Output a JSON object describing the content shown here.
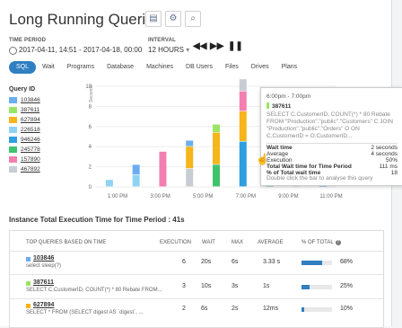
{
  "title": "Long Running Queries",
  "header": {
    "time_period_label": "TIME PERIOD",
    "time_period_value": "2017-04-11, 14:51 - 2017-04-18, 00:00",
    "interval_label": "INTERVAL",
    "interval_value": "12 HOURS",
    "interval_arrow": "▾"
  },
  "tabs": [
    "SQL",
    "Wait",
    "Programs",
    "Database",
    "Machines",
    "DB Users",
    "Files",
    "Drives",
    "Plans"
  ],
  "queries_label": "Query ID",
  "queries": [
    {
      "id": "103846",
      "color": "#6aaef0"
    },
    {
      "id": "387611",
      "color": "#9be564"
    },
    {
      "id": "627894",
      "color": "#f5b51b"
    },
    {
      "id": "226518",
      "color": "#8fd3f4"
    },
    {
      "id": "946246",
      "color": "#2f9fe0"
    },
    {
      "id": "245778",
      "color": "#3ec46d"
    },
    {
      "id": "157890",
      "color": "#f27fb0"
    },
    {
      "id": "467892",
      "color": "#c7cdd3"
    }
  ],
  "chart_data": {
    "type": "bar",
    "ylabel": "Seconds",
    "yticks": [
      "10",
      "8",
      "6",
      "4",
      "2",
      "0"
    ],
    "ylim": [
      0,
      10
    ],
    "x_ticks": [
      "1:00 PM",
      "3:00 PM",
      "5:00 PM",
      "7:00 PM",
      "9:00 PM",
      "11:00 PM"
    ],
    "series_colors": [
      "#6aaef0",
      "#9be564",
      "#f5b51b",
      "#8fd3f4",
      "#2f9fe0",
      "#3ec46d",
      "#f27fb0",
      "#c7cdd3"
    ],
    "bars": [
      {
        "stack": [
          [
            0.7,
            "#8fd3f4"
          ]
        ]
      },
      {
        "stack": [
          [
            1.2,
            "#8fd3f4"
          ],
          [
            1.0,
            "#6aaef0"
          ]
        ]
      },
      {
        "stack": [
          [
            3.5,
            "#f27fb0"
          ]
        ]
      },
      {
        "stack": [
          [
            1.8,
            "#c7cdd3"
          ],
          [
            2.2,
            "#f5b51b"
          ],
          [
            0.6,
            "#6aaef0"
          ]
        ]
      },
      {
        "stack": [
          [
            2.2,
            "#3ec46d"
          ],
          [
            3.2,
            "#f5b51b"
          ],
          [
            0.8,
            "#9be564"
          ]
        ]
      },
      {
        "stack": [
          [
            4.5,
            "#2f9fe0"
          ],
          [
            3.0,
            "#f5b51b"
          ],
          [
            2.0,
            "#f27fb0"
          ],
          [
            1.2,
            "#c7cdd3"
          ]
        ]
      },
      {
        "stack": [
          [
            2.3,
            "#3ec46d"
          ],
          [
            1.5,
            "#f5b51b"
          ],
          [
            4.0,
            "#6aaef0"
          ],
          [
            1.0,
            "#9be564"
          ]
        ]
      },
      {
        "stack": [
          [
            1.2,
            "#c7cdd3"
          ],
          [
            0.8,
            "#3ec46d"
          ]
        ]
      },
      {
        "stack": [
          [
            1.8,
            "#2f9fe0"
          ],
          [
            0.7,
            "#f5b51b"
          ]
        ]
      }
    ]
  },
  "tooltip": {
    "time_range": "6:00pm - 7:00pm",
    "query_id": "387611",
    "sql": "SELECT C.CustomerID, COUNT(*) * 80 Rebate FROM \"Production\".\"public\".\"Customers\" C JOIN \"Production\".\"public\".\"Orders\" O ON C.CustomerID = O.CustomerID...",
    "rows": [
      {
        "label": "Wait time",
        "value": "2 seconds"
      },
      {
        "label": "Average",
        "value": "4 seconds"
      },
      {
        "label": "Execution",
        "value": "50%"
      },
      {
        "label": "Total Wait time for Time Period",
        "value": "111 ms"
      },
      {
        "label": "% of Total wait time",
        "value": "18"
      }
    ],
    "hint": "Double click the bar to analyse this query"
  },
  "section_title": "Instance Total Execution Time for Time Period : 41s",
  "table": {
    "headers": [
      "TOP QUERIES BASED ON TIME",
      "EXECUTION",
      "WAIT",
      "MAX",
      "AVERAGE",
      "% OF TOTAL"
    ],
    "rows": [
      {
        "id": "103846",
        "color": "#6aaef0",
        "sql": "select sleep(?)",
        "execution": "6",
        "wait": "20s",
        "max": "6s",
        "average": "3.33 s",
        "pct": "68%",
        "pct_value": 68
      },
      {
        "id": "387611",
        "color": "#9be564",
        "sql": "SELECT C.CustomerID, COUNT(*) * 80 Rebate FROM...",
        "execution": "3",
        "wait": "10s",
        "max": "3s",
        "average": "1s",
        "pct": "25%",
        "pct_value": 25
      },
      {
        "id": "627894",
        "color": "#f5b51b",
        "sql": "SELECT * FROM (SELECT digest AS `digest`, ...",
        "execution": "2",
        "wait": "6s",
        "max": "2s",
        "average": "12ms",
        "pct": "10%",
        "pct_value": 10
      }
    ]
  }
}
